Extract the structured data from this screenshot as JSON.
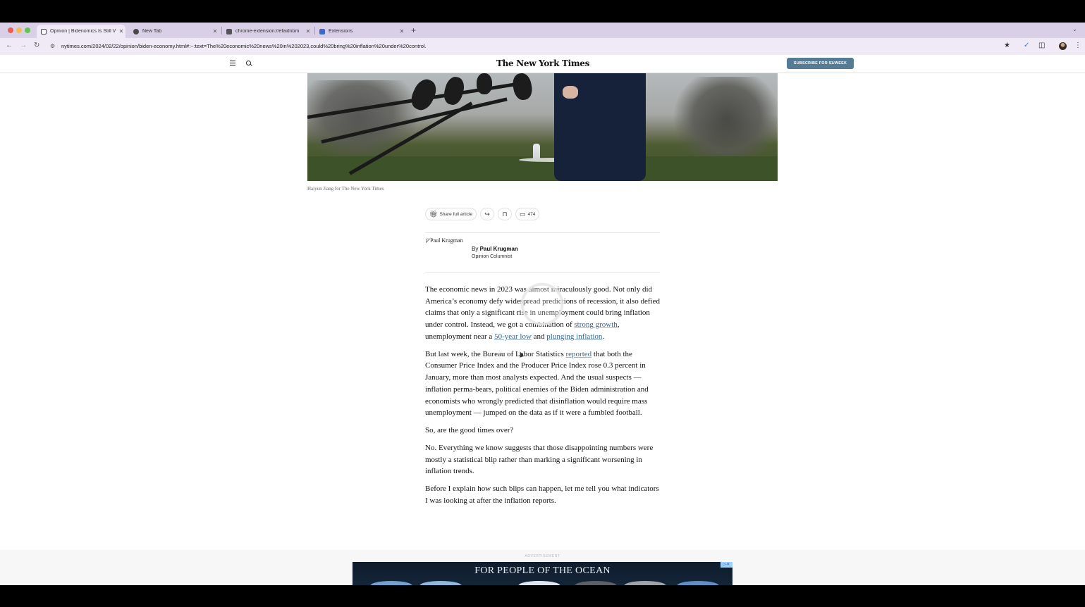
{
  "browser": {
    "tabs": [
      {
        "title": "Opinion | Bidenomics Is Still V",
        "active": true,
        "favicon": "nyt-favicon"
      },
      {
        "title": "New Tab",
        "active": false,
        "favicon": "chrome-icon"
      },
      {
        "title": "chrome-extension://efaidnbm",
        "active": false,
        "favicon": "pdf-icon"
      },
      {
        "title": "Extensions",
        "active": false,
        "favicon": "puzzle-icon"
      }
    ],
    "new_tab_symbol": "+",
    "url": "nytimes.com/2024/02/22/opinion/biden-economy.html#:~:text=The%20economic%20news%20in%202023,could%20bring%20inflation%20under%20control."
  },
  "nyt": {
    "logo": "The New York Times",
    "subscribe_label": "SUBSCRIBE FOR $1/WEEK"
  },
  "article": {
    "image_caption": "Haiyun Jiang for The New York Times",
    "share_label": "Share full article",
    "comment_count": "474",
    "author_image_alt": "Paul Krugman",
    "byline_prefix": "By ",
    "author": "Paul Krugman",
    "author_role": "Opinion Columnist",
    "p1": {
      "t1": "The economic news in 2023 was almost miraculously good. Not only did America’s economy defy widespread predictions of recession, it also defied claims that only a significant rise in unemployment could bring inflation under control. Instead, we got a combination of ",
      "link1": "strong growth",
      "t2": ", unemployment near a ",
      "link2": "50-year low",
      "t3": " and ",
      "link3": "plunging inflation",
      "t4": "."
    },
    "p2": {
      "t1": "But last week, the Bureau of Labor Statistics ",
      "link1": "reported",
      "t2": " that both the Consumer Price Index and the Producer Price Index rose 0.3 percent in January, more than most analysts expected. And the usual suspects — inflation perma-bears, political enemies of the Biden administration and economists who wrongly predicted that disinflation would require mass unemployment — jumped on the data as if it were a fumbled football."
    },
    "p3": "So, are the good times over?",
    "p4": "No. Everything we know suggests that those disappointing numbers were mostly a statistical blip rather than marking a significant worsening in inflation trends.",
    "p5": "Before I explain how such blips can happen, let me tell you what indicators I was looking at after the inflation reports."
  },
  "ad": {
    "label": "ADVERTISEMENT",
    "text": "FOR PEOPLE OF THE OCEAN"
  },
  "colors": {
    "tabstrip": "#d9cfe6",
    "toolbar": "#efeaf6",
    "subscribe": "#567b95",
    "link": "#326891"
  }
}
